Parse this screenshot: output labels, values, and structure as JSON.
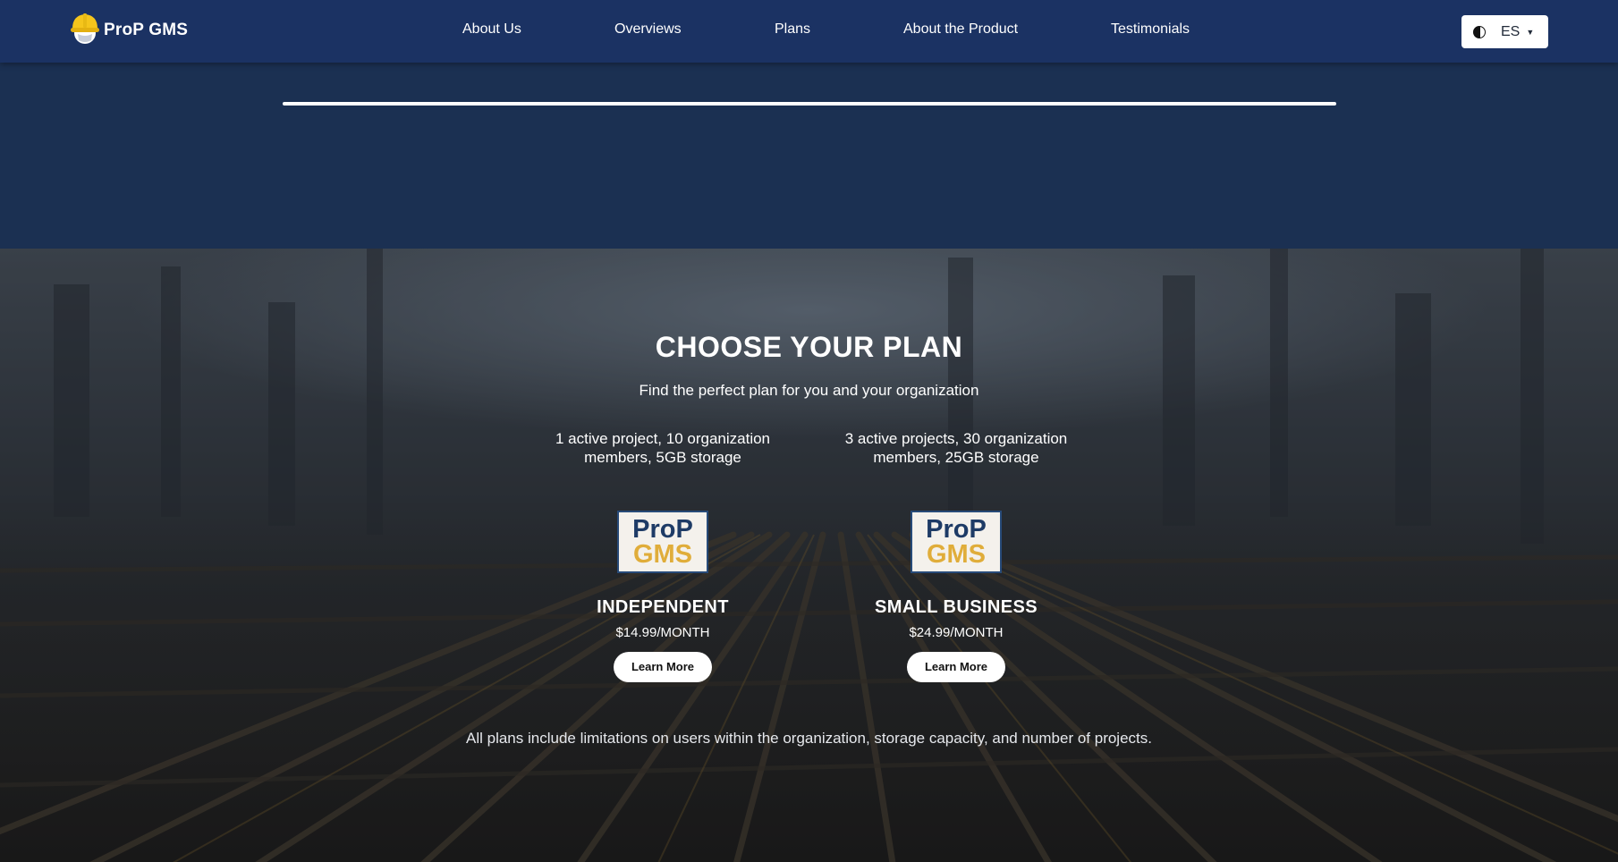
{
  "brand": {
    "name": "ProP GMS",
    "icon": "hard-hat-icon",
    "accent": "#f5c51c"
  },
  "nav": {
    "links": [
      {
        "label": "About Us"
      },
      {
        "label": "Overviews"
      },
      {
        "label": "Plans"
      },
      {
        "label": "About the Product"
      },
      {
        "label": "Testimonials"
      }
    ],
    "language": {
      "selected": "ES",
      "flag_icon": "language-flag-icon"
    }
  },
  "progress": {
    "fraction": 1.0
  },
  "hero": {
    "title": "CHOOSE YOUR PLAN",
    "subtitle": "Find the perfect plan for you and your organization",
    "footnote": "All plans include limitations on users within the organization, storage capacity, and number of projects."
  },
  "plans": [
    {
      "features": "1 active project, 10 organization members, 5GB storage",
      "logo_top": "ProP",
      "logo_bottom": "GMS",
      "name": "INDEPENDENT",
      "price": "$14.99/MONTH",
      "cta": "Learn More"
    },
    {
      "features": "3 active projects, 30 organization members, 25GB storage",
      "logo_top": "ProP",
      "logo_bottom": "GMS",
      "name": "SMALL BUSINESS",
      "price": "$24.99/MONTH",
      "cta": "Learn More"
    }
  ],
  "colors": {
    "navbar": "#1b3263",
    "band": "#1b3052",
    "logo_navy": "#1e3b66",
    "logo_gold": "#e0ad3a"
  }
}
